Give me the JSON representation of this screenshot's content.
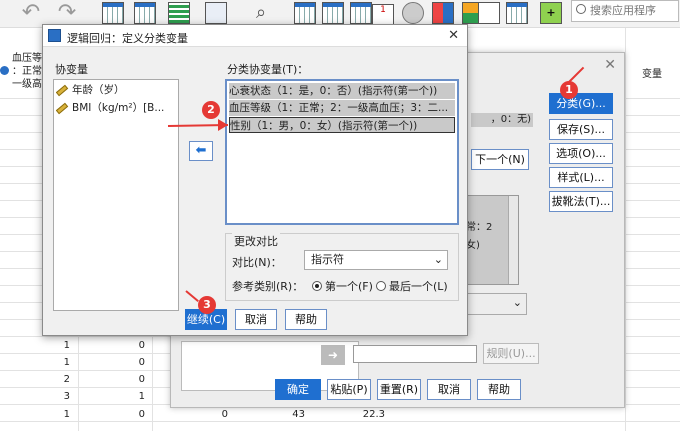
{
  "toolbar": {
    "search_placeholder": "搜索应用程序"
  },
  "sheet": {
    "left_header": [
      "血压等",
      "：正常",
      "一级高"
    ],
    "right_header": "变量",
    "rows": [
      {
        "a": "1",
        "b": "0"
      },
      {
        "a": "1",
        "b": "0"
      },
      {
        "a": "2",
        "b": "0"
      },
      {
        "a": "3",
        "b": "1"
      },
      {
        "a": "1",
        "b": "0",
        "c": "0",
        "d": "43",
        "e": "22.3"
      }
    ]
  },
  "bg_dialog": {
    "btn_category": "分类(G)...",
    "btn_save": "保存(S)...",
    "btn_options": "选项(O)...",
    "btn_style": "样式(L)...",
    "btn_bootstrap": "拔靴法(T)...",
    "partial_top": "，0：无)",
    "btn_next": "下一个(N)",
    "partial_lines": [
      "常：2",
      "女)"
    ],
    "btn_rule": "规则(U)...",
    "btn_ok": "确定",
    "btn_paste": "粘贴(P)",
    "btn_reset": "重置(R)",
    "btn_cancel": "取消",
    "btn_help": "帮助"
  },
  "dialog": {
    "title": "逻辑回归：定义分类变量",
    "covariates_label": "协变量",
    "covariates": [
      "年龄（岁）",
      "BMI（kg/m²）[B..."
    ],
    "categorical_label": "分类协变量(T)：",
    "categorical": [
      "心衰状态（1：是，0：否）(指示符(第一个))",
      "血压等级（1：正常；2：一级高血压；3：二...",
      "性别（1：男，0：女）(指示符(第一个))"
    ],
    "change_contrast_label": "更改对比",
    "contrast_label": "对比(N)：",
    "contrast_value": "指示符",
    "ref_label": "参考类别(R)：",
    "ref_first": "第一个(F)",
    "ref_last": "最后一个(L)",
    "btn_continue": "继续(C)",
    "btn_cancel": "取消",
    "btn_help": "帮助"
  },
  "annotations": [
    "1",
    "2",
    "3"
  ],
  "colors": {
    "accent": "#1f6fd0",
    "marker": "#e53935"
  }
}
